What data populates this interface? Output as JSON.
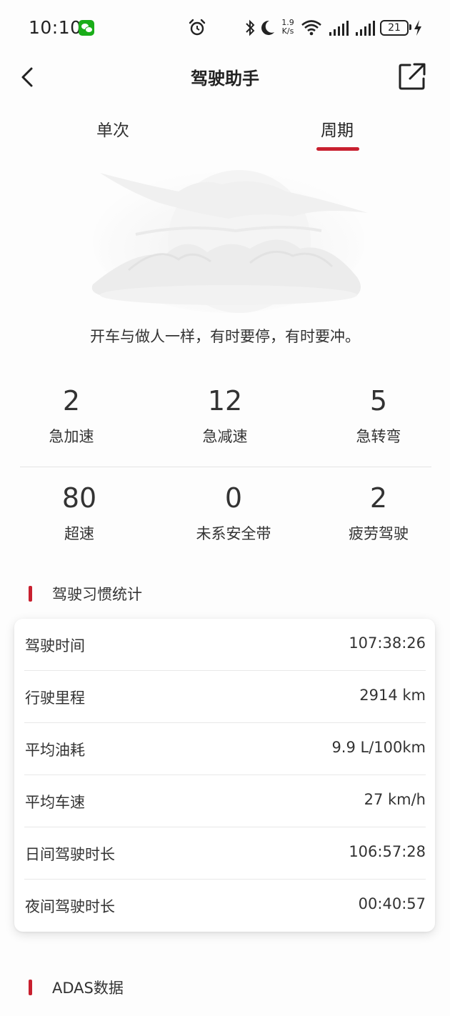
{
  "status_bar": {
    "time": "10:10",
    "net_speed_value": "1.9",
    "net_speed_unit": "K/s",
    "battery": "21"
  },
  "header": {
    "title": "驾驶助手"
  },
  "tabs": [
    {
      "label": "单次",
      "selected": false
    },
    {
      "label": "周期",
      "selected": true
    }
  ],
  "accent_color": "#c8202f",
  "motto": "开车与做人一样，有时要停，有时要冲。",
  "stats": [
    {
      "value": "2",
      "label": "急加速"
    },
    {
      "value": "12",
      "label": "急减速"
    },
    {
      "value": "5",
      "label": "急转弯"
    },
    {
      "value": "80",
      "label": "超速"
    },
    {
      "value": "0",
      "label": "未系安全带"
    },
    {
      "value": "2",
      "label": "疲劳驾驶"
    }
  ],
  "habits": {
    "title": "驾驶习惯统计",
    "rows": [
      {
        "label": "驾驶时间",
        "value": "107:38:26"
      },
      {
        "label": "行驶里程",
        "value": "2914 km"
      },
      {
        "label": "平均油耗",
        "value": "9.9 L/100km"
      },
      {
        "label": "平均车速",
        "value": "27 km/h"
      },
      {
        "label": "日间驾驶时长",
        "value": "106:57:28"
      },
      {
        "label": "夜间驾驶时长",
        "value": "00:40:57"
      }
    ]
  },
  "adas": {
    "title": "ADAS数据"
  }
}
